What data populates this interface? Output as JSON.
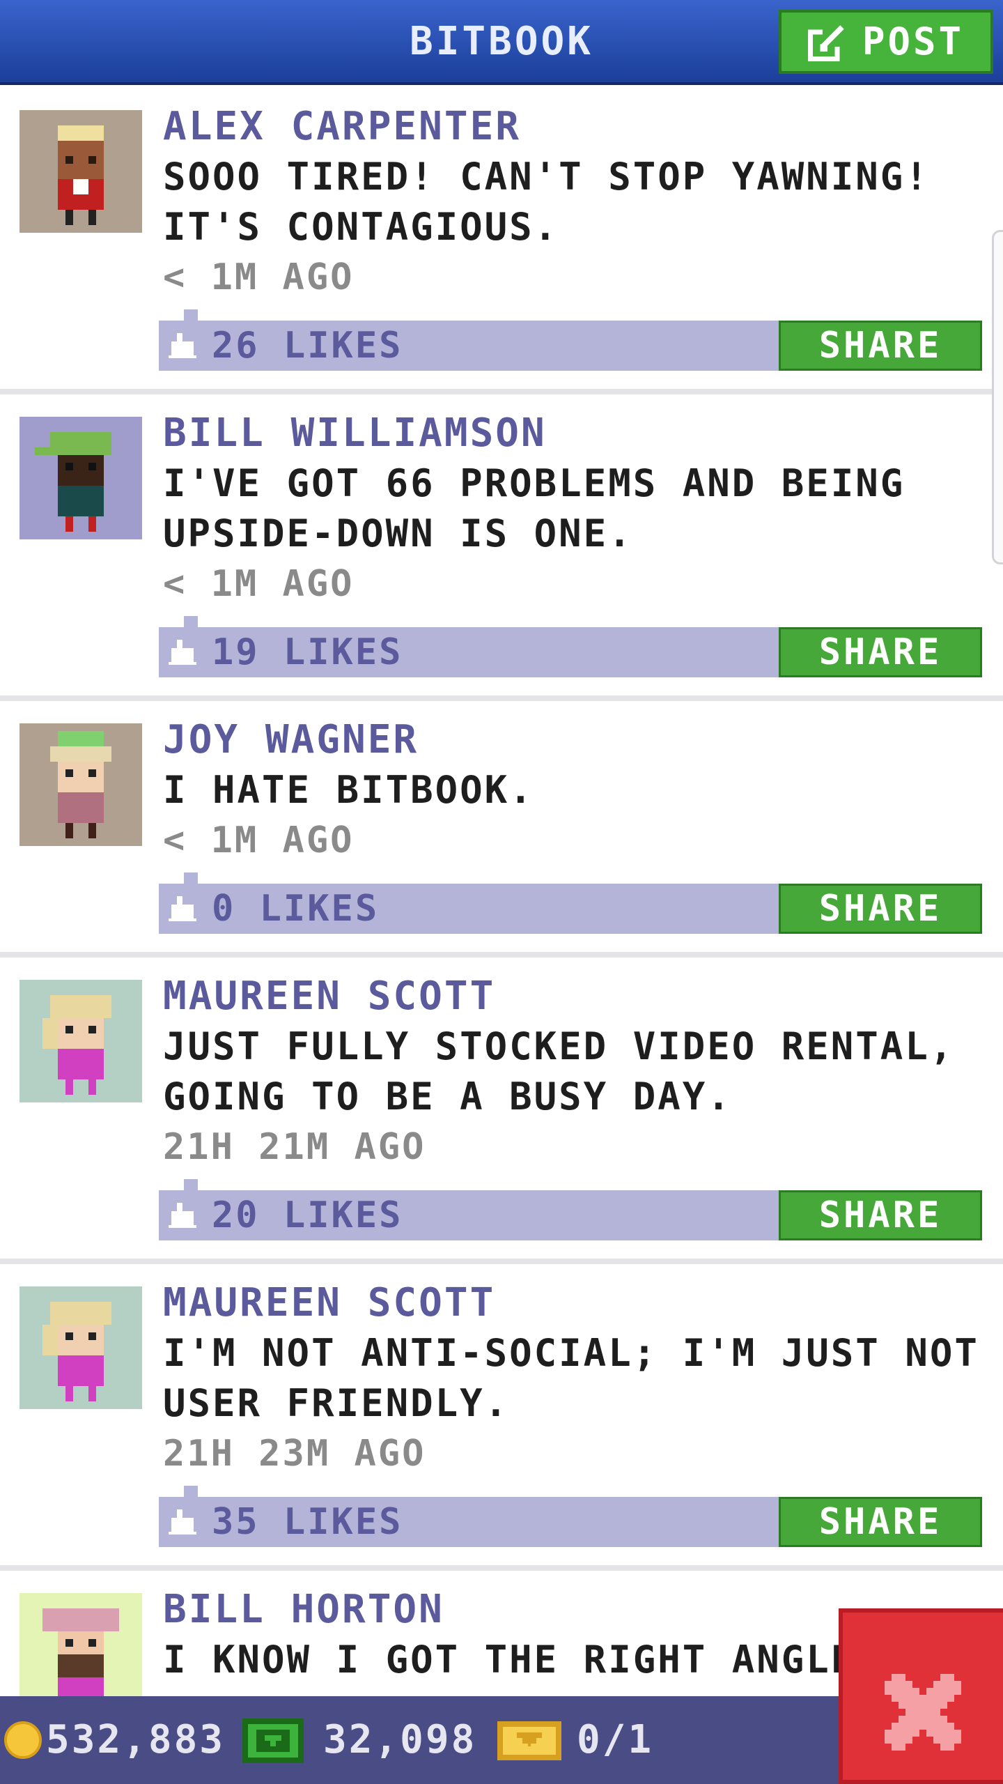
{
  "header": {
    "title": "BITBOOK",
    "post_label": "POST"
  },
  "colors": {
    "header_blue": "#2a52b8",
    "post_green": "#46b43a",
    "share_green": "#46a838",
    "likes_bar": "#b3b4d8",
    "author_purple": "#5a5a9c",
    "close_red": "#e03038",
    "bottombar": "#4a4c86"
  },
  "posts": [
    {
      "author": "ALEX CARPENTER",
      "message": "SOOO TIRED! CAN'T STOP YAWNING! IT'S CONTAGIOUS.",
      "time": "< 1M AGO",
      "likes": "26 LIKES",
      "share": "SHARE",
      "avatar_bg": "#b0a090"
    },
    {
      "author": "BILL WILLIAMSON",
      "message": "I'VE GOT 66 PROBLEMS AND BEING UPSIDE-DOWN IS ONE.",
      "time": "< 1M AGO",
      "likes": "19 LIKES",
      "share": "SHARE",
      "avatar_bg": "#a09ccc"
    },
    {
      "author": "JOY WAGNER",
      "message": "I HATE BITBOOK.",
      "time": "< 1M AGO",
      "likes": "0 LIKES",
      "share": "SHARE",
      "avatar_bg": "#b0a090"
    },
    {
      "author": "MAUREEN SCOTT",
      "message": "JUST FULLY STOCKED VIDEO RENTAL, GOING TO BE A BUSY DAY.",
      "time": "21H 21M AGO",
      "likes": "20 LIKES",
      "share": "SHARE",
      "avatar_bg": "#b4d0c4"
    },
    {
      "author": "MAUREEN SCOTT",
      "message": "I'M NOT ANTI-SOCIAL; I'M JUST NOT USER FRIENDLY.",
      "time": "21H 23M AGO",
      "likes": "35 LIKES",
      "share": "SHARE",
      "avatar_bg": "#b4d0c4"
    },
    {
      "author": "BILL HORTON",
      "message": "I KNOW I GOT THE RIGHT ANGLE",
      "avatar_bg": "#e4f4b4"
    }
  ],
  "bottombar": {
    "coins": "532,883",
    "bux": "32,098",
    "tickets": "0/1"
  },
  "icons": [
    "post-icon",
    "like-icon",
    "coin-icon",
    "bux-icon",
    "ticket-icon",
    "close-icon"
  ]
}
